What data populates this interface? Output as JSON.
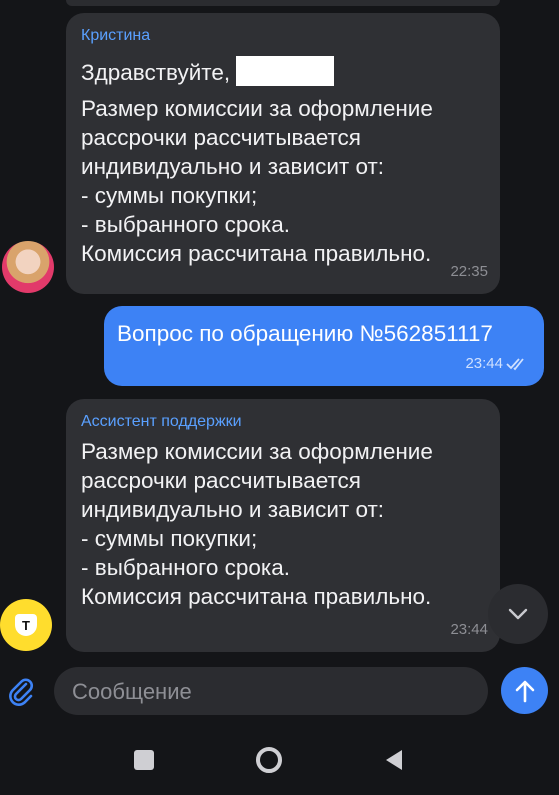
{
  "messages": [
    {
      "sender": "Кристина",
      "greeting": "Здравствуйте,",
      "text": "Размер комиссии за оформление\nрассрочки рассчитывается\nиндивидуально и зависит от:\n- суммы покупки;\n- выбранного срока.\nКомиссия рассчитана правильно.",
      "time": "22:35"
    },
    {
      "text": "Вопрос по обращению №562851117",
      "time": "23:44"
    },
    {
      "sender": "Ассистент поддержки",
      "text": "Размер комиссии за оформление\nрассрочки рассчитывается\nиндивидуально и зависит от:\n- суммы покупки;\n- выбранного срока.\nКомиссия рассчитана правильно.",
      "time": "23:44"
    }
  ],
  "bank_avatar_letter": "T",
  "composer": {
    "placeholder": "Сообщение"
  },
  "icons": {
    "attach": "paperclip-icon",
    "send": "arrow-up-icon",
    "scroll": "chevron-down-icon",
    "nav": [
      "square-icon",
      "circle-icon",
      "triangle-back-icon"
    ]
  },
  "colors": {
    "accent": "#3d82f5",
    "sender": "#5aa0ff",
    "incoming_bubble": "#2f3034",
    "background": "#141518"
  }
}
